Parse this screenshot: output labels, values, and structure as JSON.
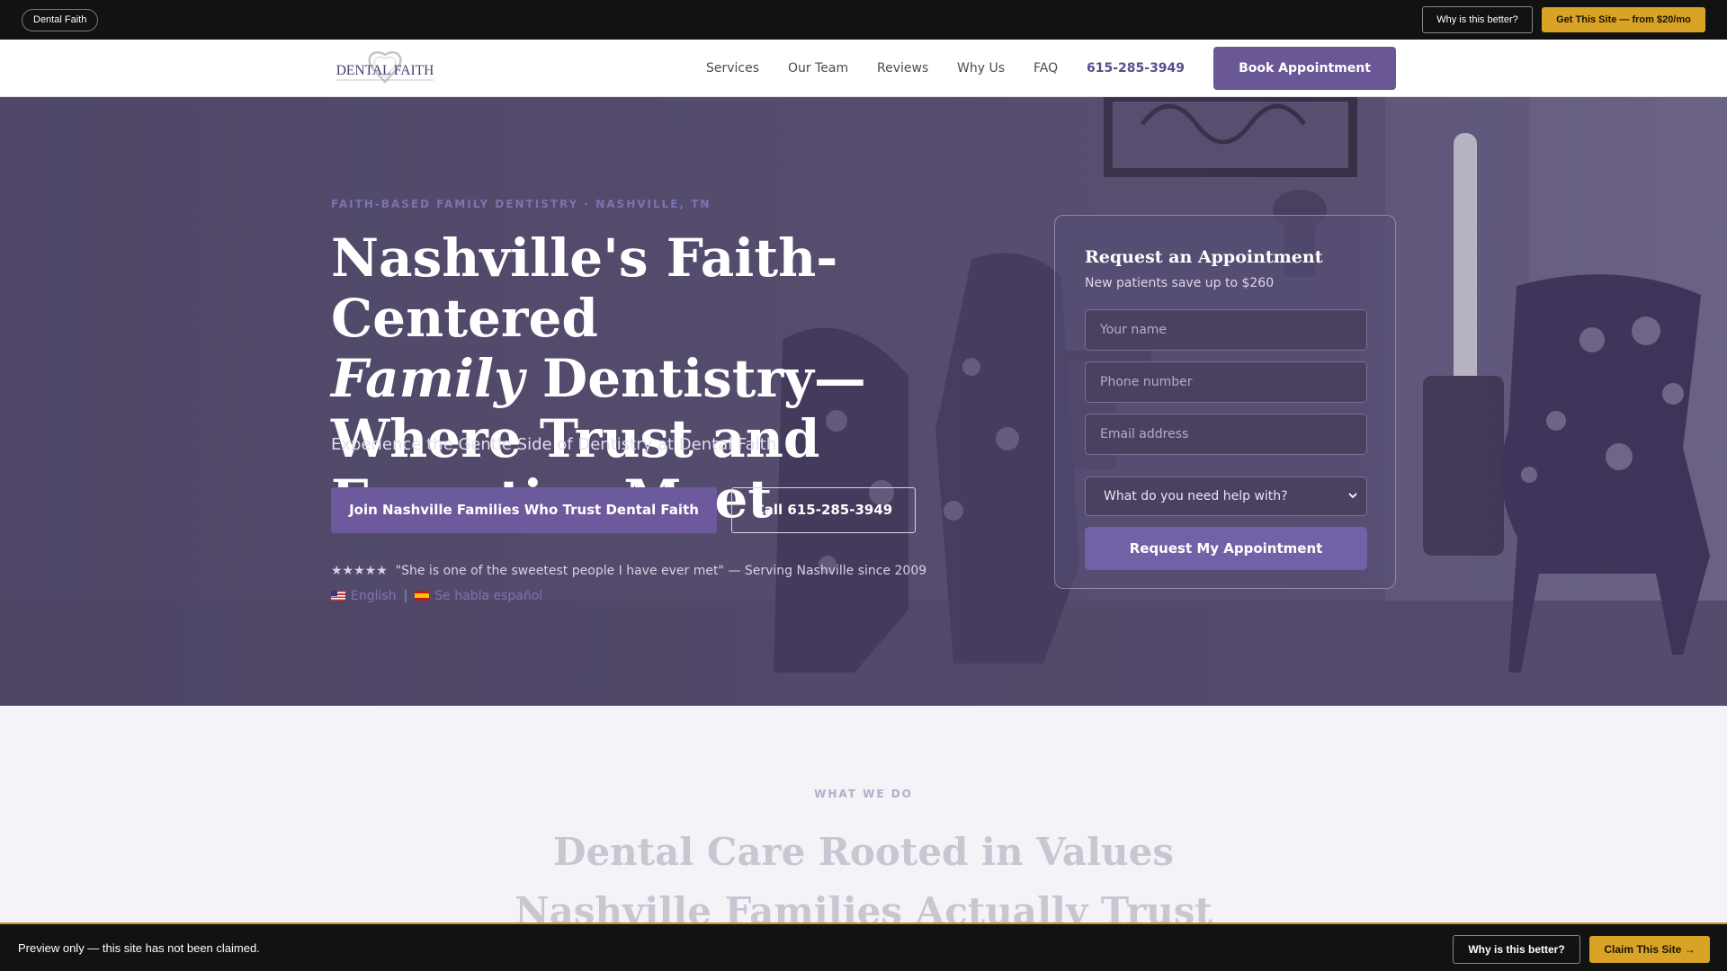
{
  "preview_bar": {
    "site_name": "Dental Faith",
    "why_label": "Why is this better?",
    "get_site_label": "Get This Site — from $20/mo"
  },
  "nav": {
    "logo_text": "DENTAL FAITH",
    "links": [
      "Services",
      "Our Team",
      "Reviews",
      "Why Us",
      "FAQ"
    ],
    "phone": "615-285-3949",
    "book_label": "Book Appointment"
  },
  "hero": {
    "eyebrow": "FAITH-BASED FAMILY DENTISTRY · NASHVILLE, TN",
    "headline_part1": "Nashville's Faith-Centered",
    "headline_em": "Family",
    "headline_part2": " Dentistry—Where Trust and Expertise Meet",
    "subhead": "Experience the Gentle Side of Dentistry at Dental Faith",
    "cta_primary": "Join Nashville Families Who Trust Dental Faith",
    "cta_secondary": "Call 615-285-3949",
    "stars": "★★★★★",
    "proof": "\"She is one of the sweetest people I have ever met\" — Serving Nashville since 2009",
    "lang_english": "English",
    "lang_separator": "|",
    "lang_spanish": "Se habla español"
  },
  "form": {
    "title": "Request an Appointment",
    "subtitle": "New patients save up to $260",
    "name_placeholder": "Your name",
    "phone_placeholder": "Phone number",
    "email_placeholder": "Email address",
    "select_value": "What do you need help with?",
    "submit_label": "Request My Appointment"
  },
  "section": {
    "eyebrow": "WHAT WE DO",
    "title_line1": "Dental Care Rooted in Values",
    "title_line2": "Nashville Families Actually Trust"
  },
  "bottom_bar": {
    "preview_text": "Preview only — this site has not been claimed.",
    "why_label": "Why is this better?",
    "claim_label": "Claim This Site →"
  },
  "colors": {
    "brand_purple": "#6a5796",
    "accent_gold": "#d8a326",
    "dark_bar": "#121212"
  }
}
